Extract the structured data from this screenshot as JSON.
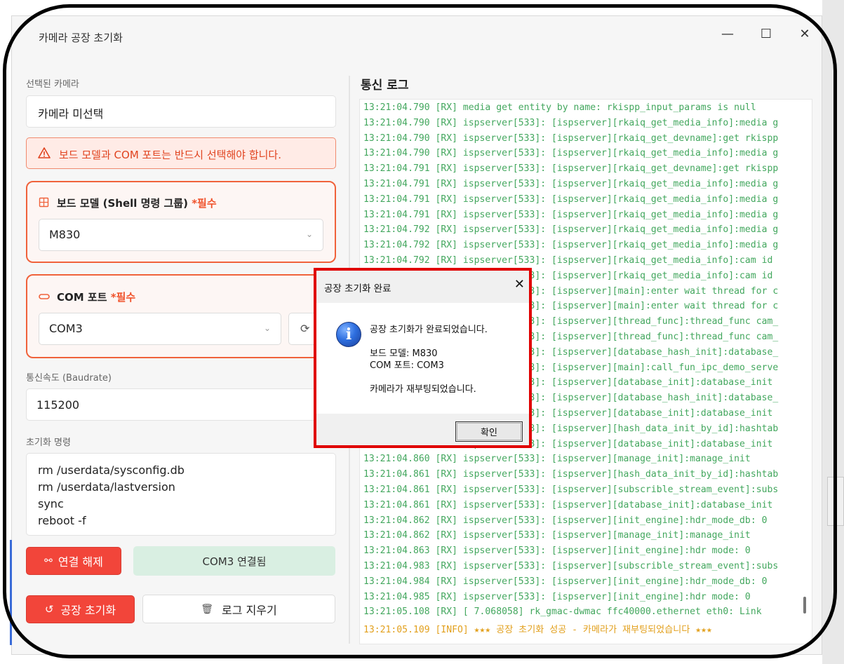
{
  "window": {
    "title": "카메라 공장 초기화",
    "minimize": "—",
    "maximize": "☐",
    "close": "✕"
  },
  "camera": {
    "label": "선택된 카메라",
    "value": "카메라 미선택"
  },
  "warning": {
    "text": "보드 모델과 COM 포트는 반드시 선택해야 합니다."
  },
  "board": {
    "title": "보드 모델 (Shell 명령 그룹)",
    "required": "*필수",
    "selected": "M830"
  },
  "com": {
    "title": "COM 포트",
    "required": "*필수",
    "selected": "COM3"
  },
  "baud": {
    "label": "통신속도 (Baudrate)",
    "value": "115200"
  },
  "init_cmd": {
    "label": "초기화 명령",
    "lines": [
      "rm /userdata/sysconfig.db",
      "rm /userdata/lastversion",
      "sync",
      "reboot -f"
    ]
  },
  "buttons": {
    "disconnect": "연결 해제",
    "status": "COM3 연결됨",
    "factory_reset": "공장 초기화",
    "clear_log": "로그 지우기"
  },
  "log": {
    "title": "통신 로그",
    "lines": [
      "13:21:04.790 [RX] media get entity by name: rkispp_input_params is null",
      "13:21:04.790 [RX] ispserver[533]: [ispserver][rkaiq_get_media_info]:media g",
      "13:21:04.790 [RX] ispserver[533]: [ispserver][rkaiq_get_devname]:get rkispp",
      "13:21:04.790 [RX] ispserver[533]: [ispserver][rkaiq_get_media_info]:media g",
      "13:21:04.791 [RX] ispserver[533]: [ispserver][rkaiq_get_devname]:get rkispp",
      "13:21:04.791 [RX] ispserver[533]: [ispserver][rkaiq_get_media_info]:media g",
      "13:21:04.791 [RX] ispserver[533]: [ispserver][rkaiq_get_media_info]:media g",
      "13:21:04.791 [RX] ispserver[533]: [ispserver][rkaiq_get_media_info]:media g",
      "13:21:04.792 [RX] ispserver[533]: [ispserver][rkaiq_get_media_info]:media g",
      "13:21:04.792 [RX] ispserver[533]: [ispserver][rkaiq_get_media_info]:media g",
      "13:21:04.792 [RX] ispserver[533]: [ispserver][rkaiq_get_media_info]:cam id",
      "13:21:04.792 [RX] ispserver[533]: [ispserver][rkaiq_get_media_info]:cam id",
      "13:21:04.792 [RX] ispserver[533]: [ispserver][main]:enter wait thread for c",
      "13:21:04.792 [RX] ispserver[533]: [ispserver][main]:enter wait thread for c",
      "13:21:04.792 [RX] ispserver[533]: [ispserver][thread_func]:thread_func cam_",
      "13:21:04.792 [RX] ispserver[533]: [ispserver][thread_func]:thread_func cam_",
      "13:21:04.792 [RX] ispserver[533]: [ispserver][database_hash_init]:database_",
      "13:21:04.792 [RX] ispserver[533]: [ispserver][main]:call_fun_ipc_demo_serve",
      "13:21:04.792 [RX] ispserver[533]: [ispserver][database_init]:database_init",
      "13:21:04.792 [RX] ispserver[533]: [ispserver][database_hash_init]:database_",
      "13:21:04.792 [RX] ispserver[533]: [ispserver][database_init]:database_init",
      "13:21:04.792 [RX] ispserver[533]: [ispserver][hash_data_init_by_id]:hashtab",
      "13:21:04.792 [RX] ispserver[533]: [ispserver][database_init]:database_init",
      "13:21:04.860 [RX] ispserver[533]: [ispserver][manage_init]:manage_init",
      "13:21:04.861 [RX] ispserver[533]: [ispserver][hash_data_init_by_id]:hashtab",
      "13:21:04.861 [RX] ispserver[533]: [ispserver][subscrible_stream_event]:subs",
      "13:21:04.861 [RX] ispserver[533]: [ispserver][database_init]:database_init",
      "13:21:04.862 [RX] ispserver[533]: [ispserver][init_engine]:hdr_mode_db: 0",
      "13:21:04.862 [RX] ispserver[533]: [ispserver][manage_init]:manage_init",
      "13:21:04.863 [RX] ispserver[533]: [ispserver][init_engine]:hdr mode: 0",
      "13:21:04.983 [RX] ispserver[533]: [ispserver][subscrible_stream_event]:subs",
      "13:21:04.984 [RX] ispserver[533]: [ispserver][init_engine]:hdr_mode_db: 0",
      "13:21:04.985 [RX] ispserver[533]: [ispserver][init_engine]:hdr mode: 0",
      "13:21:05.108 [RX] [    7.068058] rk_gmac-dwmac ffc40000.ethernet eth0: Link"
    ],
    "info_line": "13:21:05.109 [INFO] ★★★ 공장 초기화 성공 - 카메라가 재부팅되었습니다 ★★★"
  },
  "dialog": {
    "title": "공장 초기화 완료",
    "close": "✕",
    "icon": "i",
    "message": "공장 초기화가 완료되었습니다.",
    "board_line": "보드 모델: M830",
    "com_line": "COM 포트: COM3",
    "reboot_line": "카메라가 재부팅되었습니다.",
    "ok": "확인"
  }
}
